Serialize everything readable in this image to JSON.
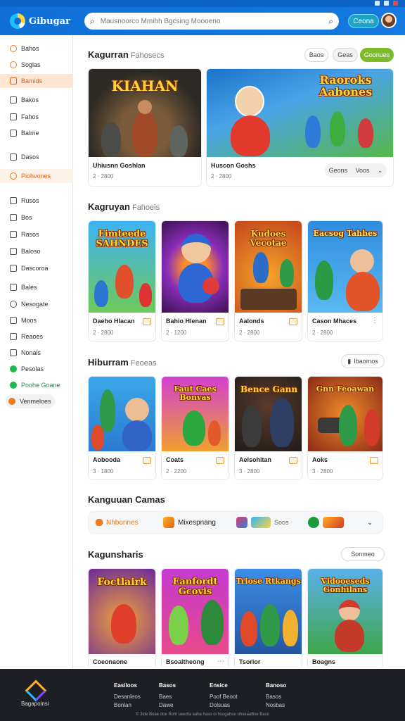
{
  "header": {
    "brand": "Gibugar",
    "search_placeholder": "Mausnoorco Mmihh Bgcsing Moooeno",
    "button_label": "Ceona"
  },
  "sidebar": {
    "items": [
      {
        "label": "Bahos"
      },
      {
        "label": "Soglas"
      },
      {
        "label": "Bamids"
      },
      {
        "label": "Bakos"
      },
      {
        "label": "Fahos"
      },
      {
        "label": "Balme"
      },
      {
        "label": "Dasos"
      },
      {
        "label": "Piohvones"
      },
      {
        "label": "Rusos"
      },
      {
        "label": "Bos"
      },
      {
        "label": "Rasos"
      },
      {
        "label": "Baloso"
      },
      {
        "label": "Dascoroa"
      },
      {
        "label": "Bales"
      },
      {
        "label": "Nesogate"
      },
      {
        "label": "Moos"
      },
      {
        "label": "Reaoes"
      },
      {
        "label": "Nonals"
      },
      {
        "label": "Pesolas"
      },
      {
        "label": "Poohe Goane"
      },
      {
        "label": "Venmeloes"
      }
    ]
  },
  "featured": {
    "title": "Kagurran",
    "subtitle": "Fahosecs",
    "chips": [
      "Baos",
      "Geas",
      "Goonues"
    ],
    "cards": [
      {
        "name": "Uhiusnn Goshlan",
        "meta": "2 · 2800",
        "art": "KIAHAN"
      },
      {
        "name": "Huscon Goshs",
        "meta": "2 · 2800",
        "art": "Raoroks Aabones"
      }
    ],
    "dropdown_left": "Geons",
    "dropdown_right": "Voos"
  },
  "section2": {
    "title": "Kagruyan",
    "subtitle": "Fahoeis",
    "cards": [
      {
        "name": "Daeho Hlacan",
        "meta": "2 · 2800",
        "art": "Fimteede SAHNDES"
      },
      {
        "name": "Bahio Hlenan",
        "meta": "2 · 1200",
        "art": ""
      },
      {
        "name": "Aalonds",
        "meta": "2 · 2800",
        "art": "Kudoes Vecotae"
      },
      {
        "name": "Cason Mhaces",
        "meta": "2 · 2800",
        "art": "Eacsog Tahhes"
      }
    ]
  },
  "section3": {
    "title": "Hiburram",
    "subtitle": "Feoeas",
    "chip": "Ibaomos",
    "cards": [
      {
        "name": "Aobooda",
        "meta": "3 · 1800",
        "art": ""
      },
      {
        "name": "Coats",
        "meta": "2 · 2200",
        "art": "Faut Caes Bonvas"
      },
      {
        "name": "Aelsohitan",
        "meta": "3 · 2800",
        "art": "Bence Gann"
      },
      {
        "name": "Aoks",
        "meta": "3 · 2800",
        "art": "Gnn Feoawan"
      }
    ]
  },
  "section4": {
    "title": "Kanguuan Camas",
    "categories": [
      {
        "label": "Nhbonnes",
        "color": "#f07a1e"
      },
      {
        "label": "Mixespnang",
        "color": "#e2621a"
      },
      {
        "label": "Soos",
        "color": "#2f7de1"
      },
      {
        "label": "",
        "color": "#1c9a3a"
      }
    ]
  },
  "section5": {
    "title": "Kagunsharis",
    "chip": "Sonmeo",
    "cards": [
      {
        "name": "Coeonaone",
        "art": "Foctlairk"
      },
      {
        "name": "Bsoaitheong",
        "art": "Eanfordt Gcovis"
      },
      {
        "name": "Tsorior",
        "art": "Triose Rtkangs"
      },
      {
        "name": "Boagns",
        "art": "Vidooeseds Gonhilans"
      }
    ]
  },
  "footer": {
    "brand": "Bagapoinsi",
    "columns": [
      {
        "head": "Easiloos",
        "links": [
          "Desanleos",
          "Bonlan"
        ]
      },
      {
        "head": "Basos",
        "links": [
          "Baes",
          "Dawe"
        ]
      },
      {
        "head": "Ensice",
        "links": [
          "Poof Beoot",
          "Dolsuas"
        ]
      },
      {
        "head": "Banoso",
        "links": [
          "Basos",
          "Nosbas"
        ]
      }
    ],
    "copyright": "© 3ide Boae doe Rohl ueedta aaha haso oi hsogahuo ohseaaBse Baso"
  },
  "colors": {
    "brand_blue": "#0f6fd6",
    "accent_orange": "#f07a1e",
    "accent_green": "#7dbb2b"
  }
}
